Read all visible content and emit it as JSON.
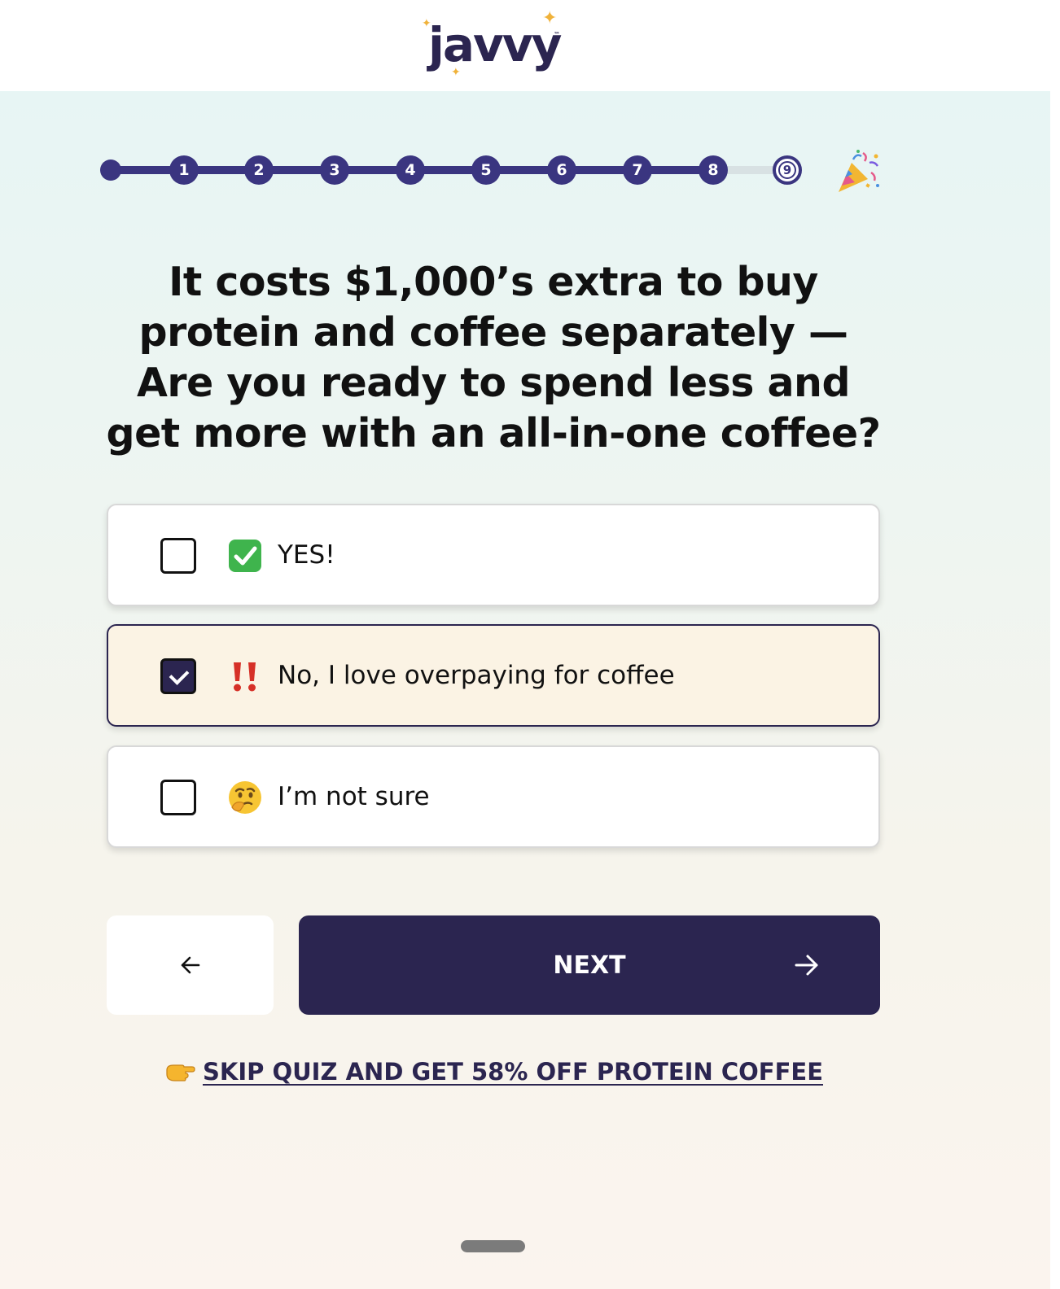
{
  "brand": {
    "logo_text": "javvy",
    "trademark": "™",
    "primary_color": "#2b2550",
    "progress_color": "#3a3580",
    "sparkle_color": "#f0b23a"
  },
  "progress": {
    "steps": [
      "1",
      "2",
      "3",
      "4",
      "5",
      "6",
      "7",
      "8",
      "9"
    ],
    "current_step": "9",
    "final_icon": "party-popper-icon"
  },
  "question": {
    "text": "It costs $1,000’s extra to buy protein and coffee separately — Are you ready to spend less and get more with an all-in-one coffee?"
  },
  "options": [
    {
      "label": "YES!",
      "icon": "check-mark-emoji-icon",
      "checked": false
    },
    {
      "label": "No, I love overpaying for coffee",
      "icon": "double-exclamation-emoji-icon",
      "checked": true
    },
    {
      "label": "I’m not sure",
      "icon": "thinking-face-emoji-icon",
      "checked": false
    }
  ],
  "nav": {
    "back_icon": "arrow-left-icon",
    "next_label": "NEXT",
    "next_icon": "arrow-right-icon"
  },
  "skip": {
    "icon": "pointing-hand-emoji-icon",
    "label": "SKIP QUIZ AND GET 58% OFF PROTEIN COFFEE"
  }
}
